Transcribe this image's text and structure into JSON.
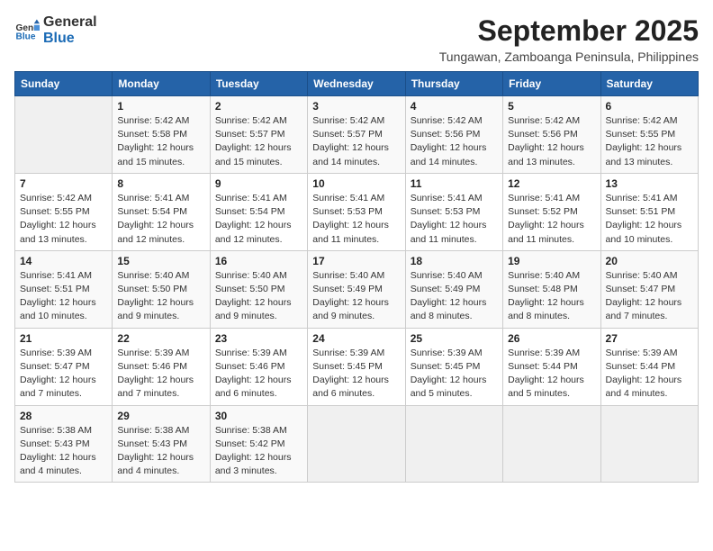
{
  "logo": {
    "text_general": "General",
    "text_blue": "Blue"
  },
  "header": {
    "month_year": "September 2025",
    "location": "Tungawan, Zamboanga Peninsula, Philippines"
  },
  "weekdays": [
    "Sunday",
    "Monday",
    "Tuesday",
    "Wednesday",
    "Thursday",
    "Friday",
    "Saturday"
  ],
  "weeks": [
    [
      {
        "day": "",
        "detail": ""
      },
      {
        "day": "1",
        "detail": "Sunrise: 5:42 AM\nSunset: 5:58 PM\nDaylight: 12 hours\nand 15 minutes."
      },
      {
        "day": "2",
        "detail": "Sunrise: 5:42 AM\nSunset: 5:57 PM\nDaylight: 12 hours\nand 15 minutes."
      },
      {
        "day": "3",
        "detail": "Sunrise: 5:42 AM\nSunset: 5:57 PM\nDaylight: 12 hours\nand 14 minutes."
      },
      {
        "day": "4",
        "detail": "Sunrise: 5:42 AM\nSunset: 5:56 PM\nDaylight: 12 hours\nand 14 minutes."
      },
      {
        "day": "5",
        "detail": "Sunrise: 5:42 AM\nSunset: 5:56 PM\nDaylight: 12 hours\nand 13 minutes."
      },
      {
        "day": "6",
        "detail": "Sunrise: 5:42 AM\nSunset: 5:55 PM\nDaylight: 12 hours\nand 13 minutes."
      }
    ],
    [
      {
        "day": "7",
        "detail": "Sunrise: 5:42 AM\nSunset: 5:55 PM\nDaylight: 12 hours\nand 13 minutes."
      },
      {
        "day": "8",
        "detail": "Sunrise: 5:41 AM\nSunset: 5:54 PM\nDaylight: 12 hours\nand 12 minutes."
      },
      {
        "day": "9",
        "detail": "Sunrise: 5:41 AM\nSunset: 5:54 PM\nDaylight: 12 hours\nand 12 minutes."
      },
      {
        "day": "10",
        "detail": "Sunrise: 5:41 AM\nSunset: 5:53 PM\nDaylight: 12 hours\nand 11 minutes."
      },
      {
        "day": "11",
        "detail": "Sunrise: 5:41 AM\nSunset: 5:53 PM\nDaylight: 12 hours\nand 11 minutes."
      },
      {
        "day": "12",
        "detail": "Sunrise: 5:41 AM\nSunset: 5:52 PM\nDaylight: 12 hours\nand 11 minutes."
      },
      {
        "day": "13",
        "detail": "Sunrise: 5:41 AM\nSunset: 5:51 PM\nDaylight: 12 hours\nand 10 minutes."
      }
    ],
    [
      {
        "day": "14",
        "detail": "Sunrise: 5:41 AM\nSunset: 5:51 PM\nDaylight: 12 hours\nand 10 minutes."
      },
      {
        "day": "15",
        "detail": "Sunrise: 5:40 AM\nSunset: 5:50 PM\nDaylight: 12 hours\nand 9 minutes."
      },
      {
        "day": "16",
        "detail": "Sunrise: 5:40 AM\nSunset: 5:50 PM\nDaylight: 12 hours\nand 9 minutes."
      },
      {
        "day": "17",
        "detail": "Sunrise: 5:40 AM\nSunset: 5:49 PM\nDaylight: 12 hours\nand 9 minutes."
      },
      {
        "day": "18",
        "detail": "Sunrise: 5:40 AM\nSunset: 5:49 PM\nDaylight: 12 hours\nand 8 minutes."
      },
      {
        "day": "19",
        "detail": "Sunrise: 5:40 AM\nSunset: 5:48 PM\nDaylight: 12 hours\nand 8 minutes."
      },
      {
        "day": "20",
        "detail": "Sunrise: 5:40 AM\nSunset: 5:47 PM\nDaylight: 12 hours\nand 7 minutes."
      }
    ],
    [
      {
        "day": "21",
        "detail": "Sunrise: 5:39 AM\nSunset: 5:47 PM\nDaylight: 12 hours\nand 7 minutes."
      },
      {
        "day": "22",
        "detail": "Sunrise: 5:39 AM\nSunset: 5:46 PM\nDaylight: 12 hours\nand 7 minutes."
      },
      {
        "day": "23",
        "detail": "Sunrise: 5:39 AM\nSunset: 5:46 PM\nDaylight: 12 hours\nand 6 minutes."
      },
      {
        "day": "24",
        "detail": "Sunrise: 5:39 AM\nSunset: 5:45 PM\nDaylight: 12 hours\nand 6 minutes."
      },
      {
        "day": "25",
        "detail": "Sunrise: 5:39 AM\nSunset: 5:45 PM\nDaylight: 12 hours\nand 5 minutes."
      },
      {
        "day": "26",
        "detail": "Sunrise: 5:39 AM\nSunset: 5:44 PM\nDaylight: 12 hours\nand 5 minutes."
      },
      {
        "day": "27",
        "detail": "Sunrise: 5:39 AM\nSunset: 5:44 PM\nDaylight: 12 hours\nand 4 minutes."
      }
    ],
    [
      {
        "day": "28",
        "detail": "Sunrise: 5:38 AM\nSunset: 5:43 PM\nDaylight: 12 hours\nand 4 minutes."
      },
      {
        "day": "29",
        "detail": "Sunrise: 5:38 AM\nSunset: 5:43 PM\nDaylight: 12 hours\nand 4 minutes."
      },
      {
        "day": "30",
        "detail": "Sunrise: 5:38 AM\nSunset: 5:42 PM\nDaylight: 12 hours\nand 3 minutes."
      },
      {
        "day": "",
        "detail": ""
      },
      {
        "day": "",
        "detail": ""
      },
      {
        "day": "",
        "detail": ""
      },
      {
        "day": "",
        "detail": ""
      }
    ]
  ]
}
